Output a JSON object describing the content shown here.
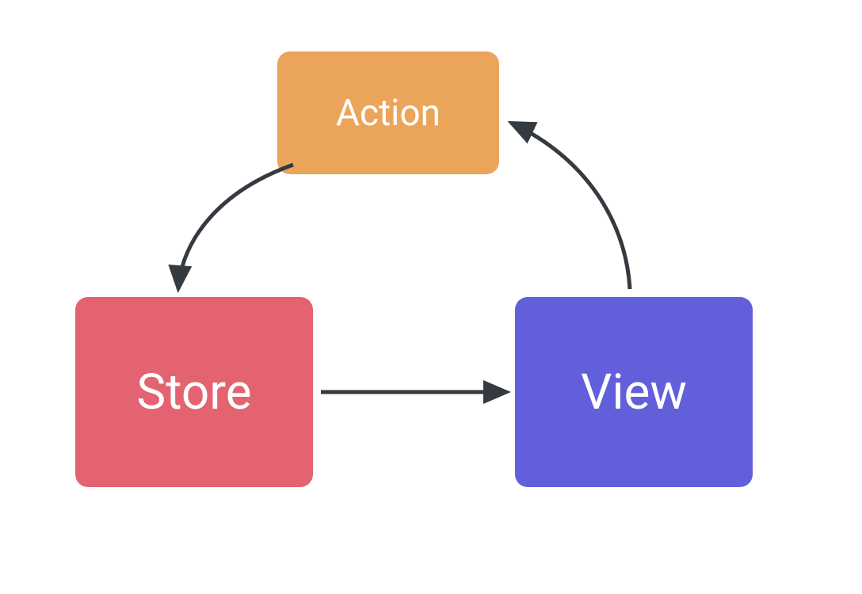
{
  "nodes": {
    "action": {
      "label": "Action",
      "color": "#eba55b"
    },
    "store": {
      "label": "Store",
      "color": "#e46371"
    },
    "view": {
      "label": "View",
      "color": "#625fdb"
    }
  },
  "edges": [
    {
      "from": "action",
      "to": "store"
    },
    {
      "from": "store",
      "to": "view"
    },
    {
      "from": "view",
      "to": "action"
    }
  ],
  "diagram_type": "unidirectional-data-flow-cycle"
}
